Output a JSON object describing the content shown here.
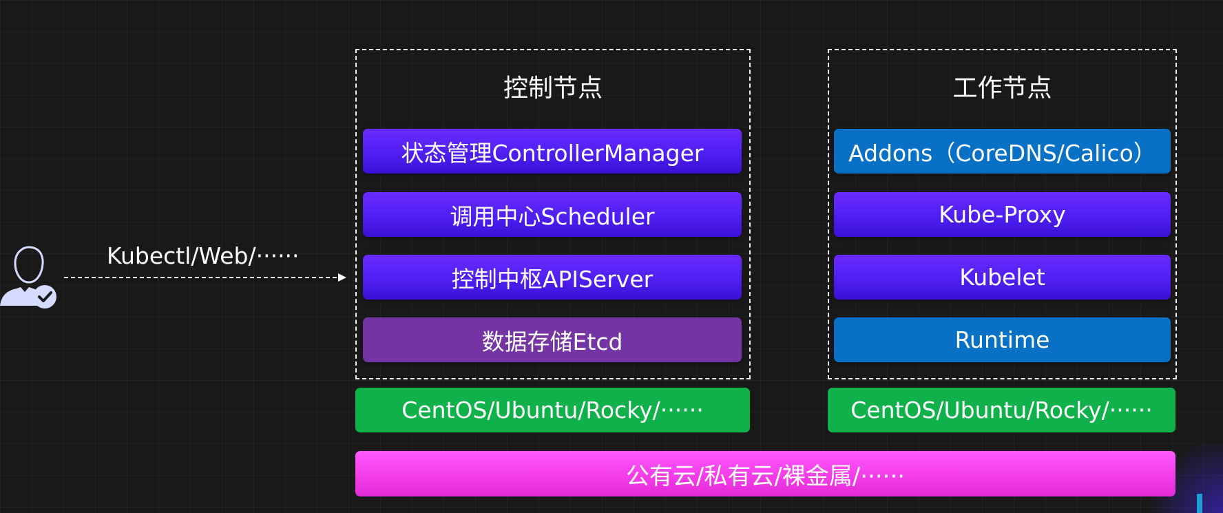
{
  "client": {
    "label": "Kubectl/Web/······",
    "user_icon": "user-check-icon"
  },
  "control_node": {
    "title": "控制节点",
    "components": [
      {
        "label": "状态管理ControllerManager",
        "color": "#5b24ff"
      },
      {
        "label": "调用中心Scheduler",
        "color": "#5b24ff"
      },
      {
        "label": "控制中枢APIServer",
        "color": "#5b24ff"
      },
      {
        "label": "数据存储Etcd",
        "color": "#7434a3"
      }
    ],
    "os": "CentOS/Ubuntu/Rocky/······"
  },
  "worker_node": {
    "title": "工作节点",
    "components": [
      {
        "label": "Addons（CoreDNS/Calico）",
        "color": "#0871c5"
      },
      {
        "label": "Kube-Proxy",
        "color": "#5b24ff"
      },
      {
        "label": "Kubelet",
        "color": "#5b24ff"
      },
      {
        "label": "Runtime",
        "color": "#0871c5"
      }
    ],
    "os": "CentOS/Ubuntu/Rocky/······"
  },
  "infrastructure": {
    "label": "公有云/私有云/裸金属/······",
    "color": "#f43de8"
  }
}
